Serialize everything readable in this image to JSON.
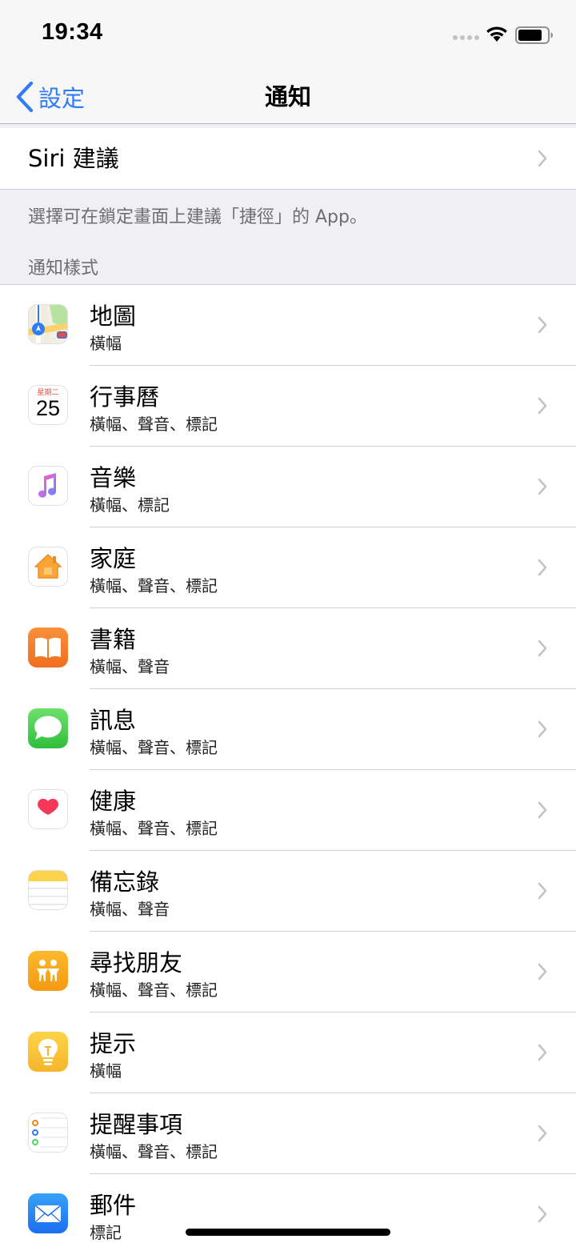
{
  "status": {
    "time": "19:34"
  },
  "nav": {
    "back_label": "設定",
    "title": "通知"
  },
  "siri_row": {
    "label": "Siri 建議"
  },
  "siri_footer": "選擇可在鎖定畫面上建議「捷徑」的 App。",
  "section_header": "通知樣式",
  "apps": [
    {
      "name": "地圖",
      "detail": "橫幅",
      "icon": "maps-icon"
    },
    {
      "name": "行事曆",
      "detail": "橫幅、聲音、標記",
      "icon": "calendar-icon",
      "icon_day_label": "星期二",
      "icon_date": "25"
    },
    {
      "name": "音樂",
      "detail": "橫幅、標記",
      "icon": "music-icon"
    },
    {
      "name": "家庭",
      "detail": "橫幅、聲音、標記",
      "icon": "home-icon"
    },
    {
      "name": "書籍",
      "detail": "橫幅、聲音",
      "icon": "books-icon"
    },
    {
      "name": "訊息",
      "detail": "橫幅、聲音、標記",
      "icon": "messages-icon"
    },
    {
      "name": "健康",
      "detail": "橫幅、聲音、標記",
      "icon": "health-icon"
    },
    {
      "name": "備忘錄",
      "detail": "橫幅、聲音",
      "icon": "notes-icon"
    },
    {
      "name": "尋找朋友",
      "detail": "橫幅、聲音、標記",
      "icon": "find-friends-icon"
    },
    {
      "name": "提示",
      "detail": "橫幅",
      "icon": "tips-icon"
    },
    {
      "name": "提醒事項",
      "detail": "橫幅、聲音、標記",
      "icon": "reminders-icon"
    },
    {
      "name": "郵件",
      "detail": "標記",
      "icon": "mail-icon"
    }
  ],
  "colors": {
    "accent": "#2f7cf6",
    "group_bg": "#efeff4",
    "secondary_text": "#6d6d72"
  }
}
